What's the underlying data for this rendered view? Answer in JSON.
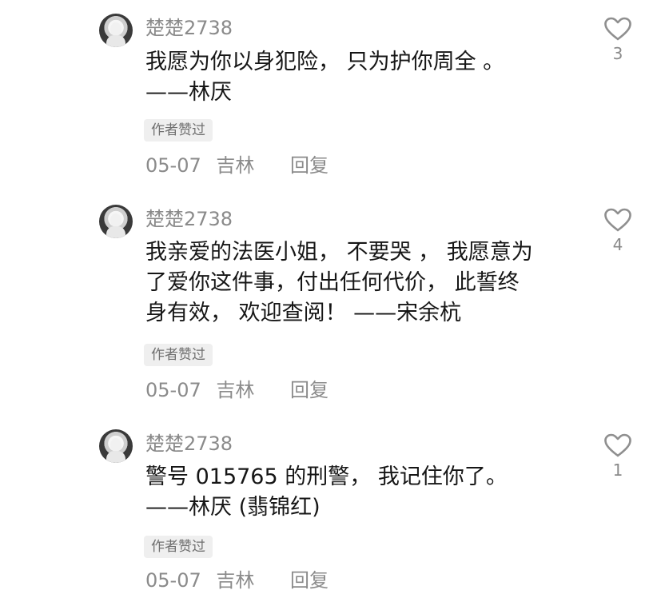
{
  "comments": [
    {
      "username": "楚楚2738",
      "lines": [
        "我愿为你以身犯险， 只为护你周全 。",
        "——林厌"
      ],
      "badge": "作者赞过",
      "date": "05-07",
      "location": "吉林",
      "reply": "回复",
      "likes": "3"
    },
    {
      "username": "楚楚2738",
      "lines": [
        "我亲爱的法医小姐， 不要哭 ， 我愿意为",
        "了爱你这件事，付出任何代价， 此誓终",
        "身有效， 欢迎查阅！ ——宋余杭"
      ],
      "badge": "作者赞过",
      "date": "05-07",
      "location": "吉林",
      "reply": "回复",
      "likes": "4"
    },
    {
      "username": "楚楚2738",
      "lines": [
        "警号 015765 的刑警， 我记住你了。",
        "——林厌 (翡锦红)"
      ],
      "badge": "作者赞过",
      "date": "05-07",
      "location": "吉林",
      "reply": "回复",
      "likes": "1"
    }
  ],
  "icons": {
    "heart": "heart-outline-icon",
    "avatar": "avatar"
  },
  "colors": {
    "text_primary": "#161616",
    "text_secondary": "#8a8a8a",
    "badge_background": "#efefef"
  }
}
